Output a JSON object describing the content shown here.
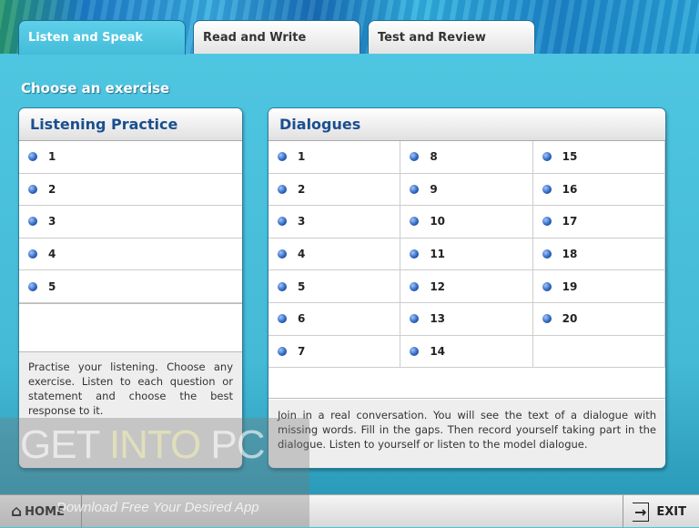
{
  "tabs": [
    {
      "label": "Listen and Speak",
      "active": true
    },
    {
      "label": "Read and Write",
      "active": false
    },
    {
      "label": "Test and Review",
      "active": false
    }
  ],
  "heading": "Choose an exercise",
  "listening": {
    "title": "Listening Practice",
    "items": [
      "1",
      "2",
      "3",
      "4",
      "5"
    ],
    "description": "Practise your listening. Choose any exercise. Listen to each question or statement and choose the best response to it."
  },
  "dialogues": {
    "title": "Dialogues",
    "columns": [
      [
        "1",
        "2",
        "3",
        "4",
        "5",
        "6",
        "7"
      ],
      [
        "8",
        "9",
        "10",
        "11",
        "12",
        "13",
        "14"
      ],
      [
        "15",
        "16",
        "17",
        "18",
        "19",
        "20"
      ]
    ],
    "description": "Join in a real conversation. You will see the text of a dialogue with missing words. Fill in the gaps. Then record yourself taking part in the dialogue. Listen to yourself or listen to the model dialogue."
  },
  "footer": {
    "home": "HOME",
    "exit": "EXIT"
  },
  "watermark": {
    "title_a": "GET ",
    "title_b": "INTO",
    "title_c": " PC",
    "tagline": "Download Free Your Desired App"
  },
  "colors": {
    "background": "#4cc3df",
    "heading_blue": "#1b4f8f",
    "bullet": "#2a5fb8"
  }
}
